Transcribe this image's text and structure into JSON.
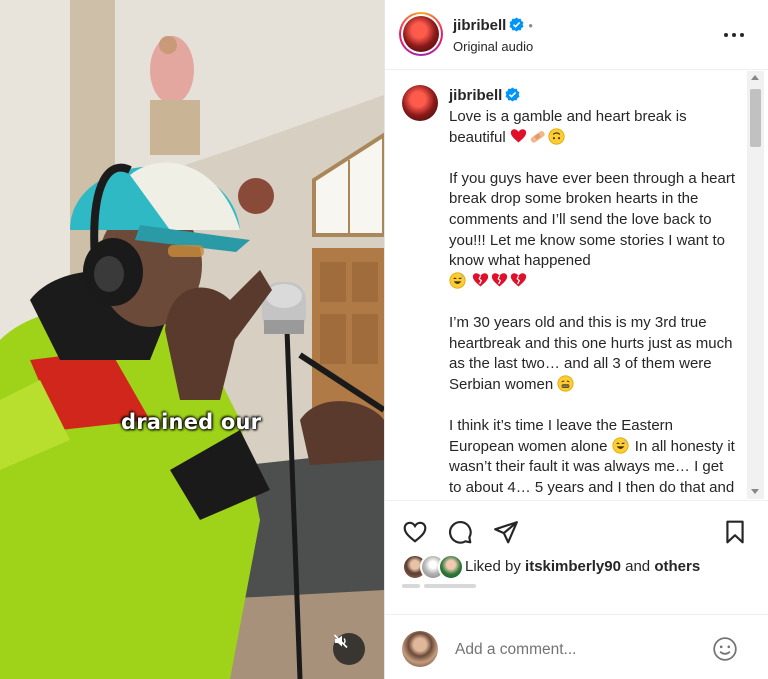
{
  "video": {
    "caption": "drained our",
    "mute_icon": "speaker-muted-icon"
  },
  "header": {
    "username": "jibribell",
    "verified_icon": "verified-badge-icon",
    "separator": "•",
    "audio": "Original audio",
    "more_icon": "more-options-icon"
  },
  "post": {
    "username": "jibribell",
    "paragraphs": [
      "Love is a gamble and heart break is beautiful",
      "If you guys have ever been through a heart break drop some broken hearts in the comments and I’ll send the love back to you!!! Let me know some stories I want to know what happened",
      "I’m 30 years old and this is my 3rd true heartbreak and this one hurts just as much as the last two… and all 3 of them were Serbian women",
      "I think it’s time I leave the Eastern European women alone",
      "In all honesty it wasn’t their fault it was always me… I get to about 4… 5 years and I then do that and want to fall"
    ]
  },
  "actions": {
    "like_icon": "heart-outline-icon",
    "comment_icon": "comment-bubble-icon",
    "share_icon": "send-paper-plane-icon",
    "save_icon": "bookmark-icon"
  },
  "likes": {
    "prefix": "Liked by",
    "user": "itskimberly90",
    "joiner": "and",
    "others": "others"
  },
  "comment_box": {
    "placeholder": "Add a comment...",
    "emoji_icon": "smiley-face-icon"
  },
  "colors": {
    "verified_blue": "#0095f6",
    "heart_red": "#e0102a",
    "text": "#262626",
    "muted": "#737373"
  }
}
